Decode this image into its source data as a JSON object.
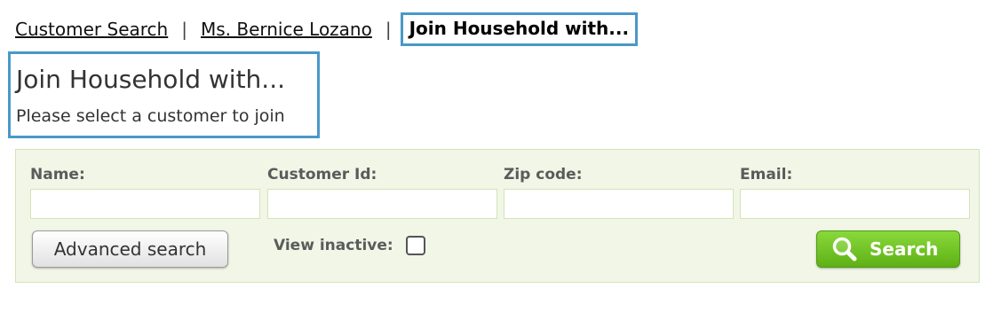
{
  "breadcrumb": {
    "items": [
      {
        "label": "Customer Search"
      },
      {
        "label": "Ms. Bernice Lozano"
      }
    ],
    "separator": "|",
    "current": "Join Household with..."
  },
  "header": {
    "title": "Join Household with...",
    "subtitle": "Please select a customer to join"
  },
  "search": {
    "fields": [
      {
        "label": "Name:",
        "value": ""
      },
      {
        "label": "Customer Id:",
        "value": ""
      },
      {
        "label": "Zip code:",
        "value": ""
      },
      {
        "label": "Email:",
        "value": ""
      }
    ],
    "advanced_label": "Advanced search",
    "inactive_label": "View inactive:",
    "inactive_checked": false,
    "search_label": "Search",
    "search_icon": "magnifier-icon"
  },
  "colors": {
    "highlight_border": "#4a98c9",
    "panel_background": "#f1f6e7",
    "panel_border": "#d3e5b6",
    "search_button": "#6cc322"
  }
}
